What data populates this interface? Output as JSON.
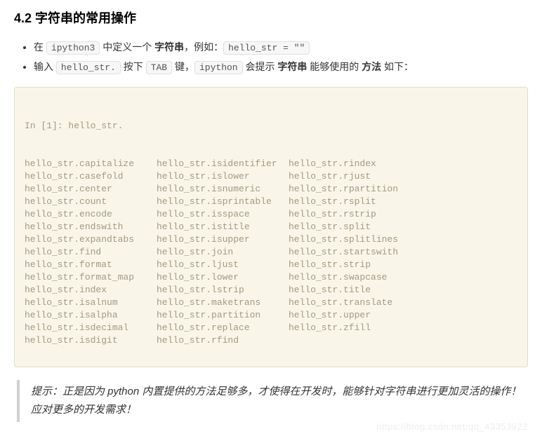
{
  "heading": "4.2 字符串的常用操作",
  "bullets": {
    "b1_pre": "在 ",
    "b1_code1": "ipython3",
    "b1_mid": " 中定义一个 ",
    "b1_bold": "字符串",
    "b1_mid2": "，例如：",
    "b1_code2": "hello_str = \"\"",
    "b2_pre": "输入 ",
    "b2_code1": "hello_str.",
    "b2_mid": " 按下 ",
    "b2_code2": "TAB",
    "b2_mid2": " 键，",
    "b2_code3": "ipython",
    "b2_mid3": " 会提示 ",
    "b2_bold1": "字符串",
    "b2_mid4": " 能够使用的 ",
    "b2_bold2": "方法",
    "b2_tail": " 如下："
  },
  "code_prompt": "In [1]: hello_str.",
  "methods": [
    [
      "hello_str.capitalize",
      "hello_str.isidentifier",
      "hello_str.rindex"
    ],
    [
      "hello_str.casefold",
      "hello_str.islower",
      "hello_str.rjust"
    ],
    [
      "hello_str.center",
      "hello_str.isnumeric",
      "hello_str.rpartition"
    ],
    [
      "hello_str.count",
      "hello_str.isprintable",
      "hello_str.rsplit"
    ],
    [
      "hello_str.encode",
      "hello_str.isspace",
      "hello_str.rstrip"
    ],
    [
      "hello_str.endswith",
      "hello_str.istitle",
      "hello_str.split"
    ],
    [
      "hello_str.expandtabs",
      "hello_str.isupper",
      "hello_str.splitlines"
    ],
    [
      "hello_str.find",
      "hello_str.join",
      "hello_str.startswith"
    ],
    [
      "hello_str.format",
      "hello_str.ljust",
      "hello_str.strip"
    ],
    [
      "hello_str.format_map",
      "hello_str.lower",
      "hello_str.swapcase"
    ],
    [
      "hello_str.index",
      "hello_str.lstrip",
      "hello_str.title"
    ],
    [
      "hello_str.isalnum",
      "hello_str.maketrans",
      "hello_str.translate"
    ],
    [
      "hello_str.isalpha",
      "hello_str.partition",
      "hello_str.upper"
    ],
    [
      "hello_str.isdecimal",
      "hello_str.replace",
      "hello_str.zfill"
    ],
    [
      "hello_str.isdigit",
      "hello_str.rfind",
      ""
    ]
  ],
  "tip": "提示：正是因为 python 内置提供的方法足够多，才使得在开发时，能够针对字符串进行更加灵活的操作！应对更多的开发需求！",
  "watermark": "https://blog.csdn.net/qq_43353922"
}
